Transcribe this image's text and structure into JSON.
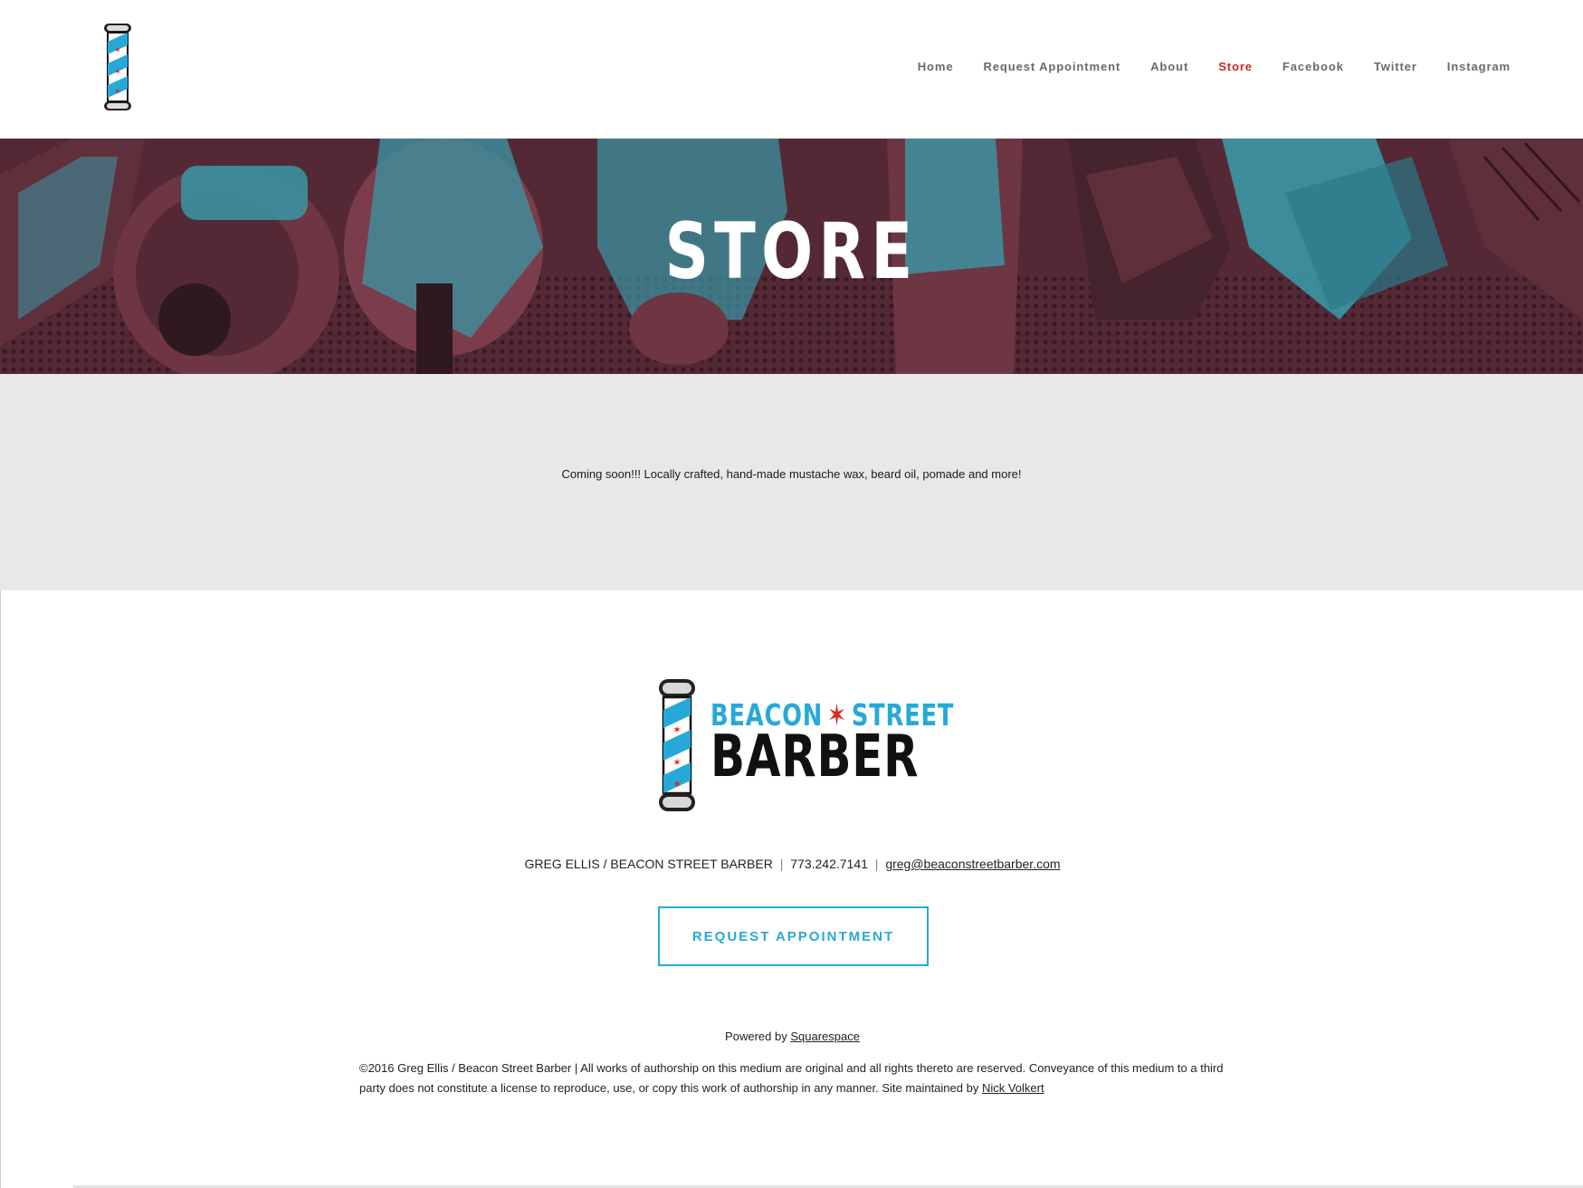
{
  "header": {
    "logo_icon": "barber-pole-icon",
    "nav": [
      {
        "label": "Home",
        "active": false
      },
      {
        "label": "Request Appointment",
        "active": false
      },
      {
        "label": "About",
        "active": false
      },
      {
        "label": "Store",
        "active": true
      },
      {
        "label": "Facebook",
        "active": false
      },
      {
        "label": "Twitter",
        "active": false
      },
      {
        "label": "Instagram",
        "active": false
      }
    ]
  },
  "banner": {
    "title": "STORE",
    "image": "barber-clippers-duotone-image"
  },
  "content": {
    "text": "Coming soon!!! Locally crafted, hand-made mustache wax, beard oil, pomade and more!"
  },
  "footer": {
    "brand_top_left": "BEACON",
    "brand_star": "✶",
    "brand_top_right": "STREET",
    "brand_bottom": "BARBER",
    "contact_name": "GREG ELLIS / BEACON STREET BARBER",
    "contact_sep": "|",
    "contact_phone": "773.242.7141",
    "contact_email": "greg@beaconstreetbarber.com",
    "cta_label": "REQUEST APPOINTMENT",
    "powered_prefix": "Powered by",
    "powered_link": "Squarespace",
    "legal_text": "©2016 Greg Ellis / Beacon Street Barber | All works of authorship on this medium are original and all rights thereto are reserved. Conveyance of this medium to a third party does not constitute a license to reproduce, use, or copy this work of authorship in any manner. Site maintained by",
    "legal_link": "Nick Volkert"
  },
  "colors": {
    "accent_blue": "#27a9d7",
    "accent_red": "#c8291f",
    "nav_gray": "#6a6a6a",
    "content_bg": "#e8e8e8",
    "banner_dark": "#4a2630",
    "banner_cyan": "#3bb3c3"
  }
}
